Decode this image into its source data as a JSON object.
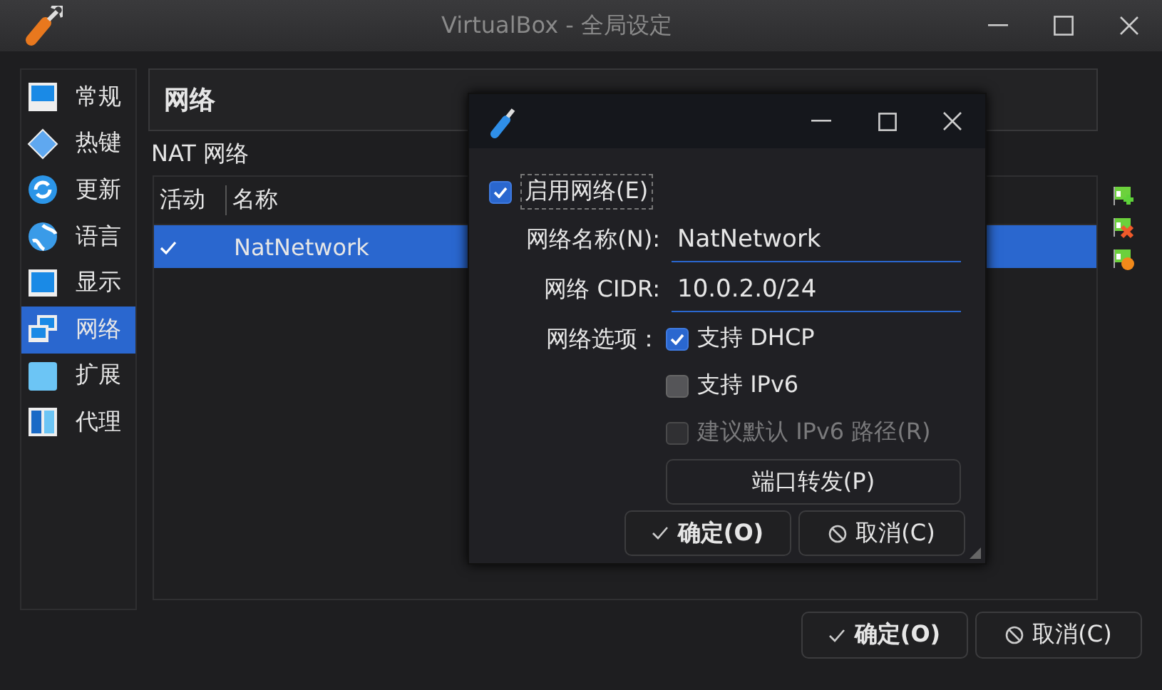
{
  "window": {
    "title": "VirtualBox - 全局设定"
  },
  "sidebar": {
    "items": [
      {
        "label": "常规",
        "selected": false
      },
      {
        "label": "热键",
        "selected": false
      },
      {
        "label": "更新",
        "selected": false
      },
      {
        "label": "语言",
        "selected": false
      },
      {
        "label": "显示",
        "selected": false
      },
      {
        "label": "网络",
        "selected": true
      },
      {
        "label": "扩展",
        "selected": false
      },
      {
        "label": "代理",
        "selected": false
      }
    ]
  },
  "page": {
    "title": "网络",
    "section_label": "NAT 网络",
    "table": {
      "columns": [
        "活动",
        "名称"
      ],
      "rows": [
        {
          "active": true,
          "name": "NatNetwork",
          "selected": true
        }
      ]
    },
    "toolbar": [
      {
        "kind": "add"
      },
      {
        "kind": "remove"
      },
      {
        "kind": "edit"
      }
    ]
  },
  "footer_buttons": [
    {
      "kind": "ok",
      "label": "确定(O)"
    },
    {
      "kind": "cancel",
      "label": "取消(C)"
    }
  ],
  "dialog": {
    "enable": {
      "label": "启用网络(E)",
      "checked": true
    },
    "fields": [
      {
        "label": "网络名称(N):",
        "value": "NatNetwork"
      },
      {
        "label": "网络 CIDR:",
        "value": "10.0.2.0/24"
      }
    ],
    "options_label": "网络选项：",
    "options": [
      {
        "label": "支持 DHCP",
        "checked": true,
        "disabled": false
      },
      {
        "label": "支持 IPv6",
        "checked": false,
        "disabled": false
      },
      {
        "label": "建议默认 IPv6 路径(R)",
        "checked": false,
        "disabled": true
      }
    ],
    "port_forward": "端口转发(P)",
    "buttons": [
      {
        "kind": "ok",
        "label": "确定(O)"
      },
      {
        "kind": "cancel",
        "label": "取消(C)"
      }
    ]
  }
}
